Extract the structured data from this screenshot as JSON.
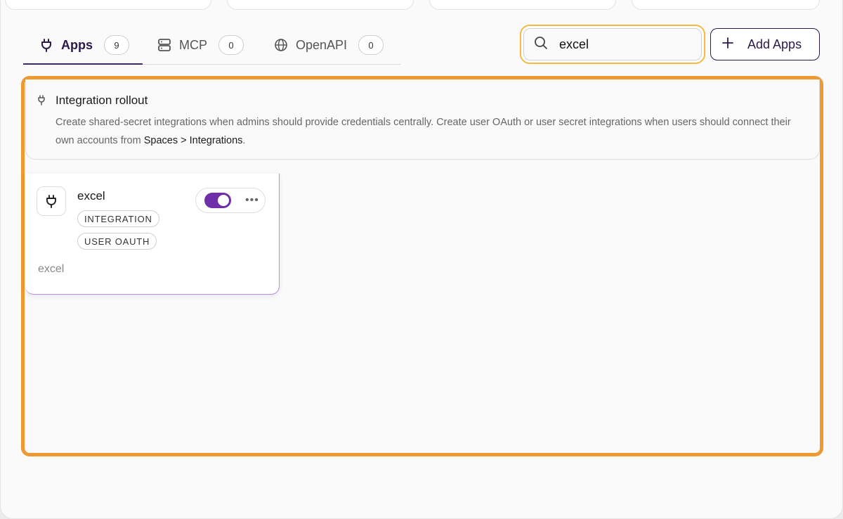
{
  "tabs": [
    {
      "label": "Apps",
      "count": "9",
      "icon": "plug-icon"
    },
    {
      "label": "MCP",
      "count": "0",
      "icon": "server-icon"
    },
    {
      "label": "OpenAPI",
      "count": "0",
      "icon": "globe-icon"
    }
  ],
  "search": {
    "value": "excel"
  },
  "add_button": {
    "label": "Add Apps"
  },
  "info": {
    "title": "Integration rollout",
    "text": "Create shared-secret integrations when admins should provide credentials centrally. Create user OAuth or user secret integrations when users should connect their own accounts from ",
    "link": "Spaces > Integrations",
    "end": "."
  },
  "card": {
    "name": "excel",
    "tags": [
      "INTEGRATION",
      "USER OAUTH"
    ],
    "description": "excel",
    "enabled": true,
    "more": "•••"
  },
  "colors": {
    "accent": "#6e2fa8",
    "highlight": "#ee9932",
    "search_focus": "#f5b942"
  }
}
